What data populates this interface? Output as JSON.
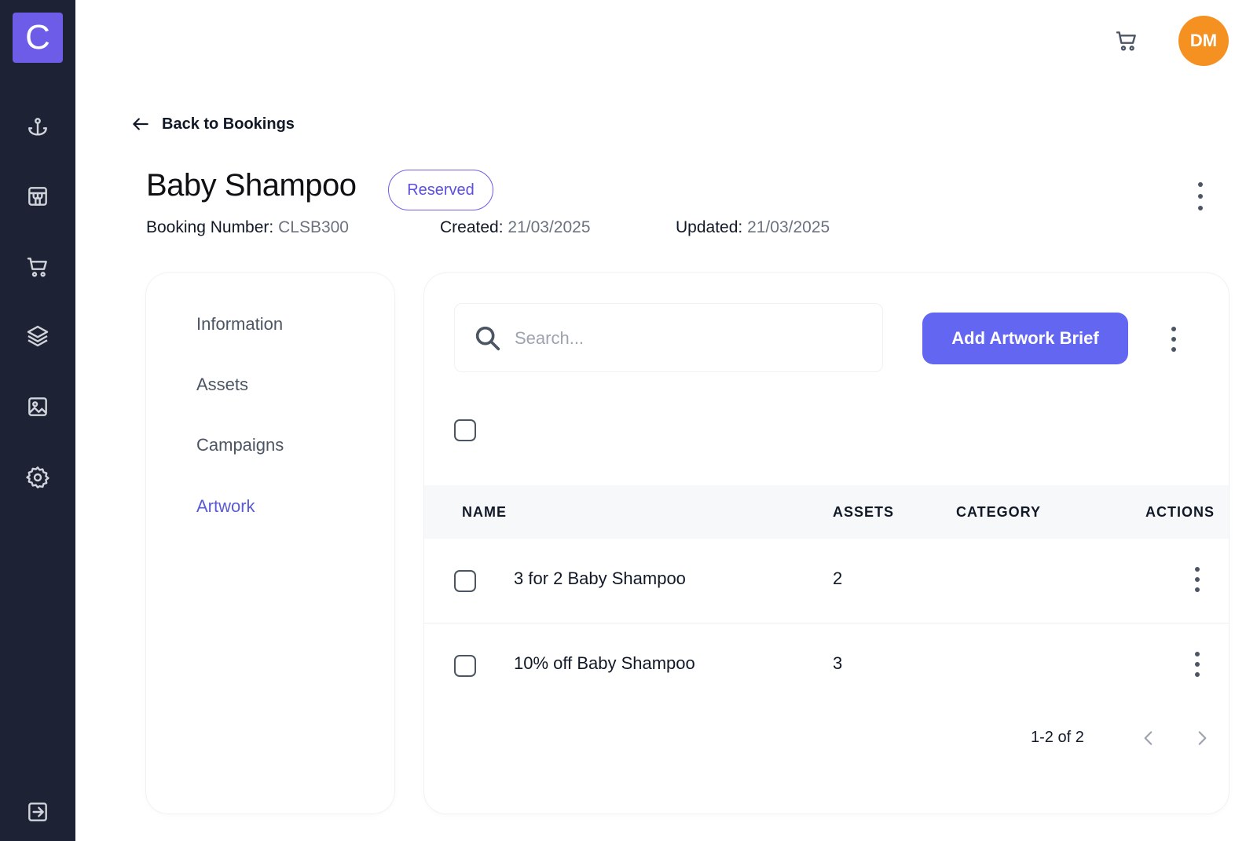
{
  "sidebar": {
    "logo_letter": "C",
    "icons": [
      "anchor-icon",
      "store-icon",
      "cart-icon",
      "layers-icon",
      "image-icon",
      "gear-icon"
    ],
    "bottom_icon": "logout-icon"
  },
  "topbar": {
    "cart_icon": "cart-icon",
    "avatar_initials": "DM"
  },
  "back_link": {
    "label": "Back to Bookings"
  },
  "header": {
    "title": "Baby Shampoo",
    "status": "Reserved",
    "booking_number_label": "Booking Number:",
    "booking_number": "CLSB300",
    "created_label": "Created:",
    "created": "21/03/2025",
    "updated_label": "Updated:",
    "updated": "21/03/2025"
  },
  "nav": {
    "items": [
      {
        "label": "Information"
      },
      {
        "label": "Assets"
      },
      {
        "label": "Campaigns"
      },
      {
        "label": "Artwork"
      }
    ],
    "active": "Artwork"
  },
  "main": {
    "search_placeholder": "Search...",
    "add_button": "Add Artwork Brief",
    "columns": [
      "NAME",
      "ASSETS",
      "CATEGORY",
      "ACTIONS"
    ],
    "rows": [
      {
        "name": "3 for 2 Baby Shampoo",
        "assets": "2",
        "category": ""
      },
      {
        "name": "10% off Baby Shampoo",
        "assets": "3",
        "category": ""
      }
    ],
    "pagination": "1-2 of 2"
  },
  "colors": {
    "sidebar_bg": "#1e2235",
    "accent": "#6366f1",
    "avatar": "#f59121"
  }
}
